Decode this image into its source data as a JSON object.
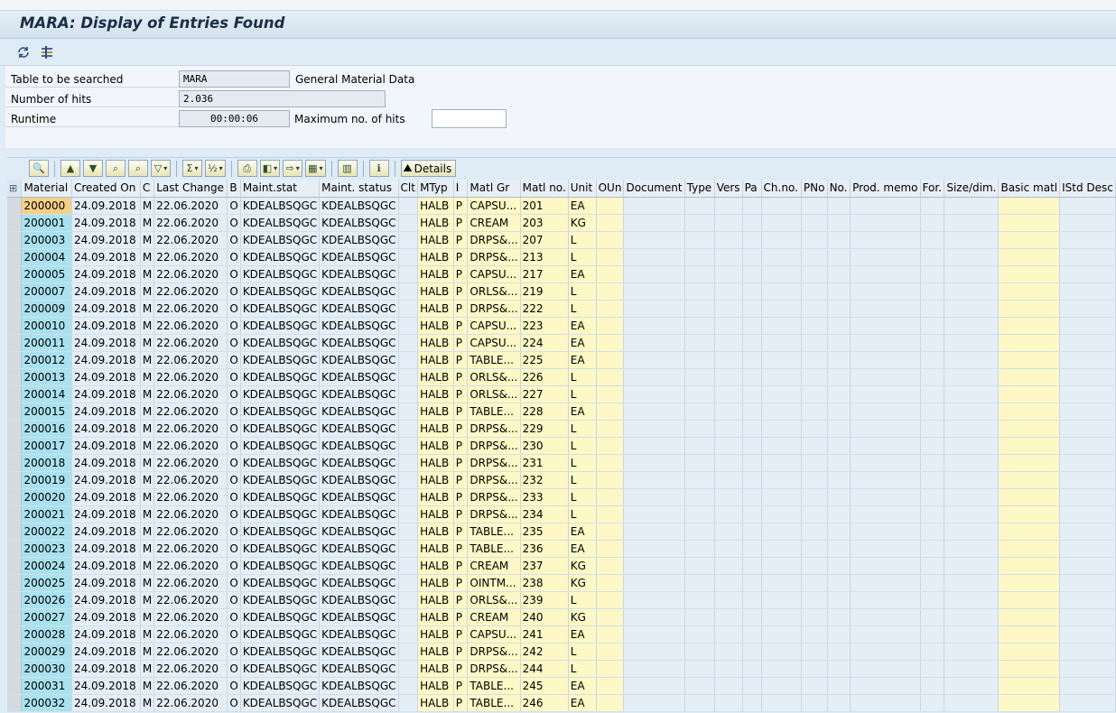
{
  "title": "MARA: Display of Entries Found",
  "app_toolbar": {
    "icons": [
      "refresh-icon",
      "selection-settings-icon"
    ]
  },
  "form": {
    "table_label": "Table to be searched",
    "table_value": "MARA",
    "table_desc": "General Material Data",
    "hits_label": "Number of hits",
    "hits_value": "2.036",
    "runtime_label": "Runtime",
    "runtime_value": "00:00:06",
    "maxhits_label": "Maximum no. of hits",
    "maxhits_value": ""
  },
  "alv_toolbar": {
    "details_label": "Details",
    "icons": [
      "details-view-icon",
      "sort-ascending-icon",
      "sort-descending-icon",
      "find-icon",
      "find-next-icon",
      "filter-icon",
      "sum-icon",
      "subtotal-icon",
      "print-icon",
      "view-icon",
      "export-icon",
      "layout-icon",
      "graphic-icon",
      "info-icon",
      "details-icon"
    ]
  },
  "columns": [
    "Material",
    "Created On",
    "C",
    "Last Change",
    "B",
    "Maint.stat",
    "Maint. status",
    "Clt",
    "MTyp",
    "I",
    "Matl Gr",
    "Matl no.",
    "Unit",
    "OUn",
    "Document",
    "Type",
    "Vers",
    "Pa",
    "Ch.no.",
    "PNo",
    "No.",
    "Prod. memo",
    "For.",
    "Size/dim.",
    "Basic matl",
    "IStd Desc"
  ],
  "rows": [
    [
      "200000",
      "24.09.2018",
      "M",
      "22.06.2020",
      "O",
      "KDEALBSQGC",
      "KDEALBSQGC",
      "",
      "HALB",
      "P",
      "CAPSU...",
      "201",
      "EA"
    ],
    [
      "200001",
      "24.09.2018",
      "M",
      "22.06.2020",
      "O",
      "KDEALBSQGC",
      "KDEALBSQGC",
      "",
      "HALB",
      "P",
      "CREAM",
      "203",
      "KG"
    ],
    [
      "200003",
      "24.09.2018",
      "M",
      "22.06.2020",
      "O",
      "KDEALBSQGC",
      "KDEALBSQGC",
      "",
      "HALB",
      "P",
      "DRPS&...",
      "207",
      "L"
    ],
    [
      "200004",
      "24.09.2018",
      "M",
      "22.06.2020",
      "O",
      "KDEALBSQGC",
      "KDEALBSQGC",
      "",
      "HALB",
      "P",
      "DRPS&...",
      "213",
      "L"
    ],
    [
      "200005",
      "24.09.2018",
      "M",
      "22.06.2020",
      "O",
      "KDEALBSQGC",
      "KDEALBSQGC",
      "",
      "HALB",
      "P",
      "CAPSU...",
      "217",
      "EA"
    ],
    [
      "200007",
      "24.09.2018",
      "M",
      "22.06.2020",
      "O",
      "KDEALBSQGC",
      "KDEALBSQGC",
      "",
      "HALB",
      "P",
      "ORLS&...",
      "219",
      "L"
    ],
    [
      "200009",
      "24.09.2018",
      "M",
      "22.06.2020",
      "O",
      "KDEALBSQGC",
      "KDEALBSQGC",
      "",
      "HALB",
      "P",
      "DRPS&...",
      "222",
      "L"
    ],
    [
      "200010",
      "24.09.2018",
      "M",
      "22.06.2020",
      "O",
      "KDEALBSQGC",
      "KDEALBSQGC",
      "",
      "HALB",
      "P",
      "CAPSU...",
      "223",
      "EA"
    ],
    [
      "200011",
      "24.09.2018",
      "M",
      "22.06.2020",
      "O",
      "KDEALBSQGC",
      "KDEALBSQGC",
      "",
      "HALB",
      "P",
      "CAPSU...",
      "224",
      "EA"
    ],
    [
      "200012",
      "24.09.2018",
      "M",
      "22.06.2020",
      "O",
      "KDEALBSQGC",
      "KDEALBSQGC",
      "",
      "HALB",
      "P",
      "TABLE...",
      "225",
      "EA"
    ],
    [
      "200013",
      "24.09.2018",
      "M",
      "22.06.2020",
      "O",
      "KDEALBSQGC",
      "KDEALBSQGC",
      "",
      "HALB",
      "P",
      "ORLS&...",
      "226",
      "L"
    ],
    [
      "200014",
      "24.09.2018",
      "M",
      "22.06.2020",
      "O",
      "KDEALBSQGC",
      "KDEALBSQGC",
      "",
      "HALB",
      "P",
      "ORLS&...",
      "227",
      "L"
    ],
    [
      "200015",
      "24.09.2018",
      "M",
      "22.06.2020",
      "O",
      "KDEALBSQGC",
      "KDEALBSQGC",
      "",
      "HALB",
      "P",
      "TABLE...",
      "228",
      "EA"
    ],
    [
      "200016",
      "24.09.2018",
      "M",
      "22.06.2020",
      "O",
      "KDEALBSQGC",
      "KDEALBSQGC",
      "",
      "HALB",
      "P",
      "DRPS&...",
      "229",
      "L"
    ],
    [
      "200017",
      "24.09.2018",
      "M",
      "22.06.2020",
      "O",
      "KDEALBSQGC",
      "KDEALBSQGC",
      "",
      "HALB",
      "P",
      "DRPS&...",
      "230",
      "L"
    ],
    [
      "200018",
      "24.09.2018",
      "M",
      "22.06.2020",
      "O",
      "KDEALBSQGC",
      "KDEALBSQGC",
      "",
      "HALB",
      "P",
      "DRPS&...",
      "231",
      "L"
    ],
    [
      "200019",
      "24.09.2018",
      "M",
      "22.06.2020",
      "O",
      "KDEALBSQGC",
      "KDEALBSQGC",
      "",
      "HALB",
      "P",
      "DRPS&...",
      "232",
      "L"
    ],
    [
      "200020",
      "24.09.2018",
      "M",
      "22.06.2020",
      "O",
      "KDEALBSQGC",
      "KDEALBSQGC",
      "",
      "HALB",
      "P",
      "DRPS&...",
      "233",
      "L"
    ],
    [
      "200021",
      "24.09.2018",
      "M",
      "22.06.2020",
      "O",
      "KDEALBSQGC",
      "KDEALBSQGC",
      "",
      "HALB",
      "P",
      "DRPS&...",
      "234",
      "L"
    ],
    [
      "200022",
      "24.09.2018",
      "M",
      "22.06.2020",
      "O",
      "KDEALBSQGC",
      "KDEALBSQGC",
      "",
      "HALB",
      "P",
      "TABLE...",
      "235",
      "EA"
    ],
    [
      "200023",
      "24.09.2018",
      "M",
      "22.06.2020",
      "O",
      "KDEALBSQGC",
      "KDEALBSQGC",
      "",
      "HALB",
      "P",
      "TABLE...",
      "236",
      "EA"
    ],
    [
      "200024",
      "24.09.2018",
      "M",
      "22.06.2020",
      "O",
      "KDEALBSQGC",
      "KDEALBSQGC",
      "",
      "HALB",
      "P",
      "CREAM",
      "237",
      "KG"
    ],
    [
      "200025",
      "24.09.2018",
      "M",
      "22.06.2020",
      "O",
      "KDEALBSQGC",
      "KDEALBSQGC",
      "",
      "HALB",
      "P",
      "OINTM...",
      "238",
      "KG"
    ],
    [
      "200026",
      "24.09.2018",
      "M",
      "22.06.2020",
      "O",
      "KDEALBSQGC",
      "KDEALBSQGC",
      "",
      "HALB",
      "P",
      "ORLS&...",
      "239",
      "L"
    ],
    [
      "200027",
      "24.09.2018",
      "M",
      "22.06.2020",
      "O",
      "KDEALBSQGC",
      "KDEALBSQGC",
      "",
      "HALB",
      "P",
      "CREAM",
      "240",
      "KG"
    ],
    [
      "200028",
      "24.09.2018",
      "M",
      "22.06.2020",
      "O",
      "KDEALBSQGC",
      "KDEALBSQGC",
      "",
      "HALB",
      "P",
      "CAPSU...",
      "241",
      "EA"
    ],
    [
      "200029",
      "24.09.2018",
      "M",
      "22.06.2020",
      "O",
      "KDEALBSQGC",
      "KDEALBSQGC",
      "",
      "HALB",
      "P",
      "DRPS&...",
      "242",
      "L"
    ],
    [
      "200030",
      "24.09.2018",
      "M",
      "22.06.2020",
      "O",
      "KDEALBSQGC",
      "KDEALBSQGC",
      "",
      "HALB",
      "P",
      "DRPS&...",
      "244",
      "L"
    ],
    [
      "200031",
      "24.09.2018",
      "M",
      "22.06.2020",
      "O",
      "KDEALBSQGC",
      "KDEALBSQGC",
      "",
      "HALB",
      "P",
      "TABLE...",
      "245",
      "EA"
    ],
    [
      "200032",
      "24.09.2018",
      "M",
      "22.06.2020",
      "O",
      "KDEALBSQGC",
      "KDEALBSQGC",
      "",
      "HALB",
      "P",
      "TABLE...",
      "246",
      "EA"
    ]
  ]
}
